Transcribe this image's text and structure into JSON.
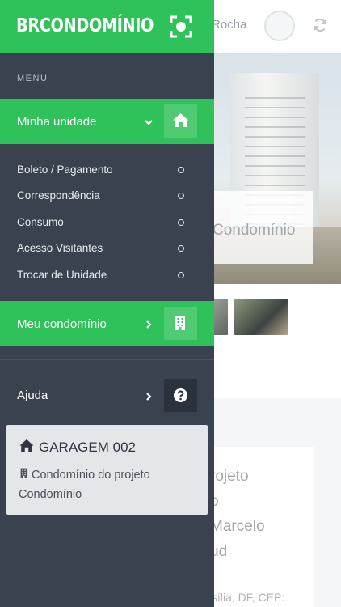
{
  "background": {
    "user_name": "Rocha",
    "hero_title": "Condomínio",
    "card_lines": [
      "rojeto",
      "o",
      "Marcelo",
      "ud"
    ],
    "address": "sília, DF, CEP:"
  },
  "drawer": {
    "logo": "BRCONDOMÍNIO",
    "menu_label": "MENU",
    "minha_unidade": {
      "label": "Minha unidade",
      "items": [
        {
          "label": "Boleto / Pagamento"
        },
        {
          "label": "Correspondência"
        },
        {
          "label": "Consumo"
        },
        {
          "label": "Acesso Visitantes"
        },
        {
          "label": "Trocar de Unidade"
        }
      ]
    },
    "meu_condominio": {
      "label": "Meu condomínio"
    },
    "ajuda": {
      "label": "Ajuda"
    },
    "unit_card": {
      "unit_name": "GARAGEM 002",
      "condominio_name": "Condomínio do projeto Condomínio"
    }
  },
  "colors": {
    "accent_green": "#2fc25a",
    "drawer_bg": "#3a4250",
    "card_bg": "#e4e7ea"
  },
  "icons": [
    "scan-icon",
    "chevron-down-icon",
    "home-icon",
    "chevron-right-icon",
    "building-icon",
    "question-circle-icon",
    "refresh-icon"
  ]
}
